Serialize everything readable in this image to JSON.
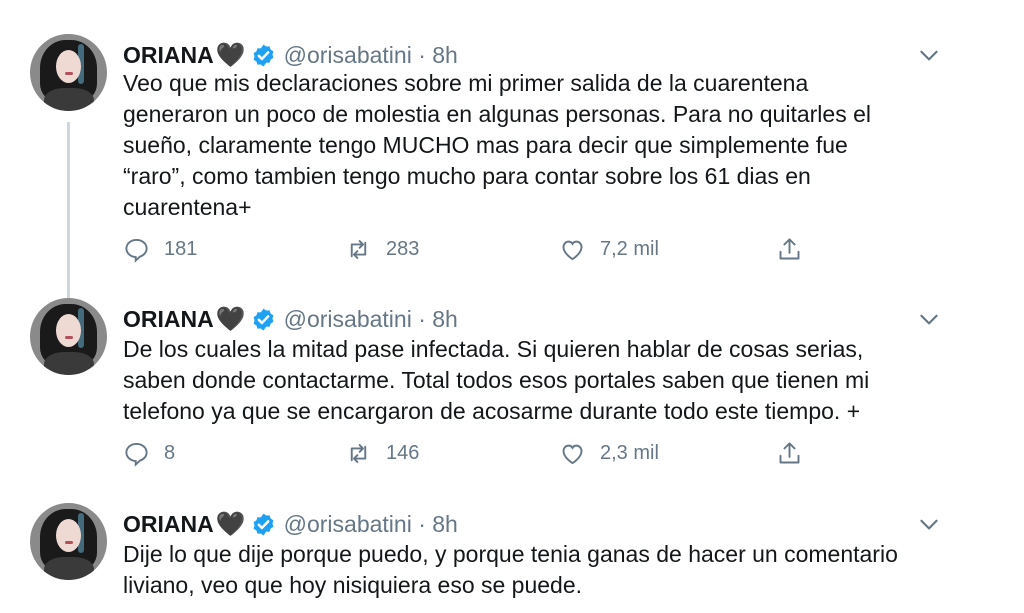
{
  "tweets": [
    {
      "name": "ORIANA",
      "heart": "🖤",
      "handle": "@orisabatini · 8h",
      "lines": [
        "Veo que mis declaraciones sobre mi primer salida de la cuarentena",
        "generaron un poco de molestia en algunas personas. Para no quitarles el",
        "sueño, claramente tengo MUCHO mas para decir que simplemente fue",
        "“raro”, como tambien tengo mucho para contar sobre los 61 dias en",
        "cuarentena+"
      ],
      "replies": "181",
      "retweets": "283",
      "likes": "7,2 mil"
    },
    {
      "name": "ORIANA",
      "heart": "🖤",
      "handle": "@orisabatini · 8h",
      "lines": [
        "De los cuales la mitad pase infectada. Si quieren hablar de cosas serias,",
        "saben donde contactarme. Total todos esos portales saben que tienen mi",
        "telefono ya que se encargaron de acosarme durante todo este tiempo. +"
      ],
      "replies": "8",
      "retweets": "146",
      "likes": "2,3 mil"
    },
    {
      "name": "ORIANA",
      "heart": "🖤",
      "handle": "@orisabatini · 8h",
      "lines": [
        "Dije lo que dije porque puedo, y porque tenia ganas de hacer un comentario",
        "liviano, veo que hoy nisiquiera eso se puede."
      ]
    }
  ],
  "icons": {
    "verified": "verified-badge-icon",
    "reply": "reply-icon",
    "retweet": "retweet-icon",
    "like": "heart-icon",
    "share": "share-icon",
    "more": "chevron-down-icon"
  },
  "colors": {
    "verified": "#1da1f2",
    "muted": "#657786",
    "text": "#14171a",
    "thread_line": "#ccd6dd"
  }
}
